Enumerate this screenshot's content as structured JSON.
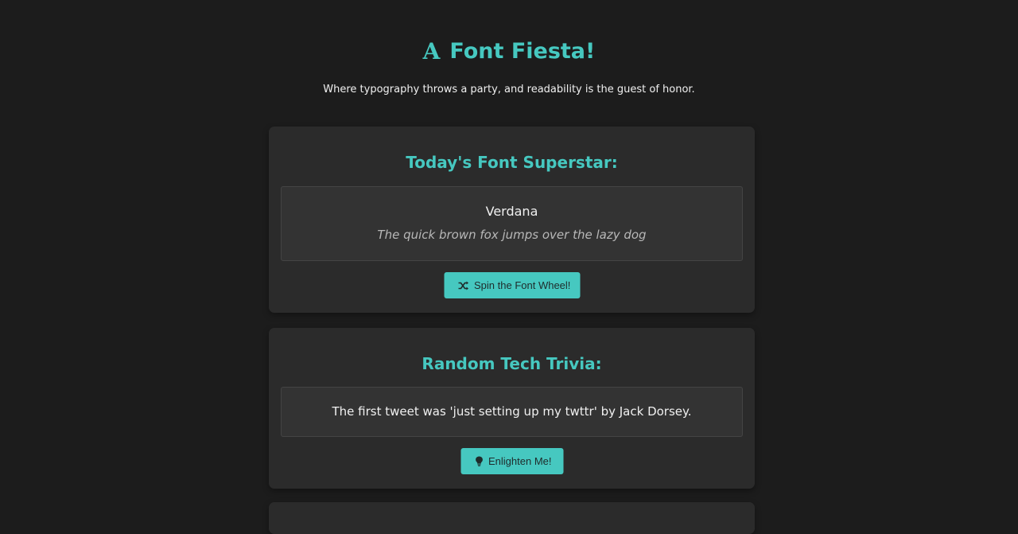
{
  "header": {
    "title": "Font Fiesta!",
    "title_icon": "font-icon",
    "title_icon_glyph": "A",
    "subtitle": "Where typography throws a party, and readability is the guest of honor."
  },
  "font_card": {
    "heading": "Today's Font Superstar:",
    "font_name": "Verdana",
    "sample": "The quick brown fox jumps over the lazy dog",
    "button_label": "Spin the Font Wheel!",
    "button_icon": "shuffle-icon"
  },
  "trivia_card": {
    "heading": "Random Tech Trivia:",
    "fact": "The first tweet was 'just setting up my twttr' by Jack Dorsey.",
    "button_label": "Enlighten Me!",
    "button_icon": "lightbulb-icon"
  },
  "colors": {
    "accent": "#46c8c0",
    "background": "#1c1c1c",
    "card": "#2b2b2b",
    "inner_box": "#333333"
  }
}
